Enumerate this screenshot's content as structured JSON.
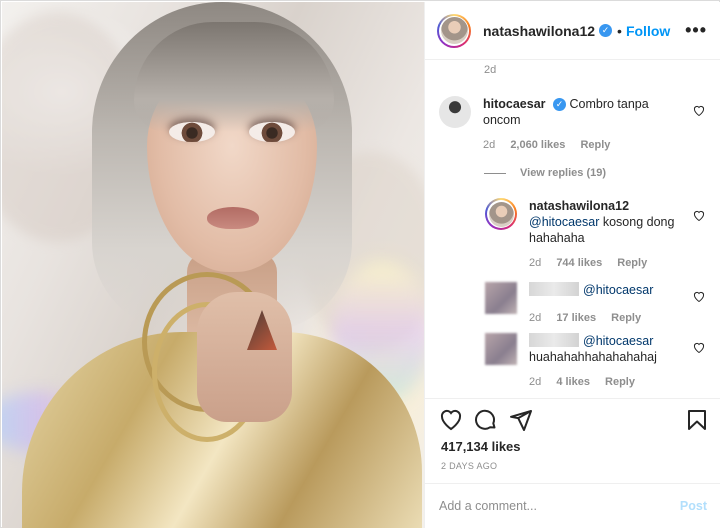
{
  "post": {
    "username": "natashawilona12",
    "follow_label": "Follow",
    "more_label": "•••",
    "separator": "•",
    "verified_mark": "✓",
    "top_comment_age": "2d"
  },
  "comments": [
    {
      "username": "hitocaesar",
      "verified": true,
      "text": "Combro tanpa oncom",
      "age": "2d",
      "likes": "2,060 likes",
      "reply_label": "Reply",
      "view_replies": "View replies (19)"
    }
  ],
  "replies": [
    {
      "username": "natashawilona12",
      "mention": "@hitocaesar",
      "text": " kosong dong hahahaha",
      "age": "2d",
      "likes": "744 likes",
      "reply_label": "Reply"
    },
    {
      "username": "",
      "mention": "@hitocaesar",
      "text": "",
      "age": "2d",
      "likes": "17 likes",
      "reply_label": "Reply"
    },
    {
      "username": "",
      "mention": "@hitocaesar",
      "text": "huahahahhahahahahaj",
      "age": "2d",
      "likes": "4 likes",
      "reply_label": "Reply"
    }
  ],
  "actions": {
    "icons": [
      "heart-icon",
      "comment-icon",
      "share-icon",
      "bookmark-icon"
    ],
    "likes_count": "417,134 likes",
    "posted_ago": "2 DAYS AGO"
  },
  "add_comment": {
    "placeholder": "Add a comment...",
    "post_label": "Post"
  },
  "colors": {
    "accent": "#0095f6",
    "verified": "#3897f0",
    "muted": "#8e8e8e",
    "post_disabled": "#b2dffc"
  }
}
